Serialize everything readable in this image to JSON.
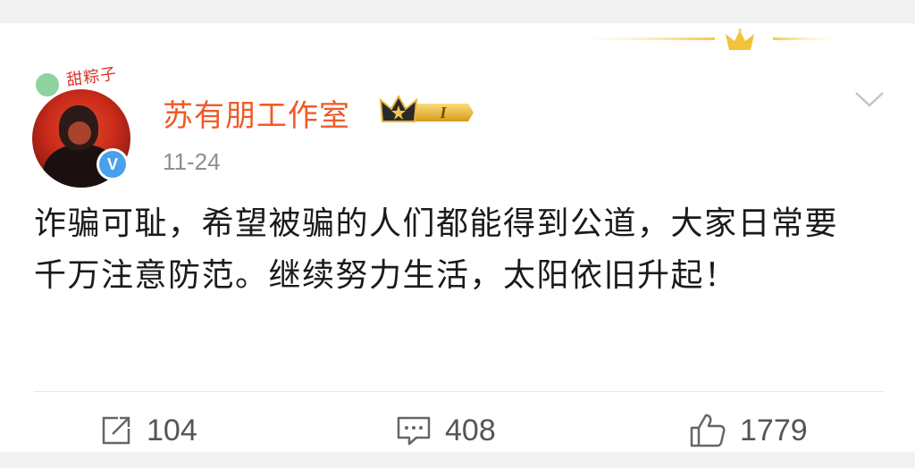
{
  "post": {
    "author": "苏有朋工作室",
    "vip_level": "I",
    "time": "11-24",
    "avatar_text": "甜粽子",
    "verified_mark": "V",
    "text": "诈骗可耻，希望被骗的人们都能得到公道，大家日常要千万注意防范。继续努力生活，太阳依旧升起！"
  },
  "actions": {
    "share_count": "104",
    "comment_count": "408",
    "like_count": "1779"
  },
  "colors": {
    "name": "#f05a28",
    "verified": "#4aa0ec",
    "gold": "#e8b53a"
  }
}
